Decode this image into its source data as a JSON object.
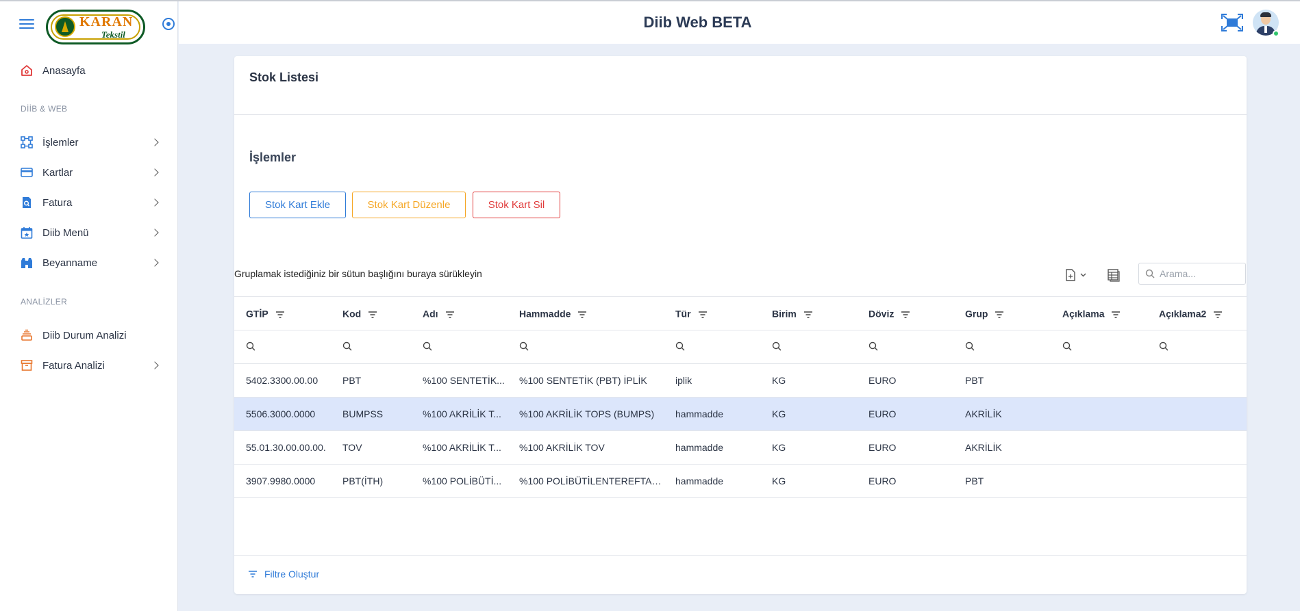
{
  "app": {
    "title": "Diib Web BETA",
    "logo_text": "KARAN",
    "logo_subtext": "Tekstil"
  },
  "sidebar": {
    "items": [
      {
        "label": "Anasayfa",
        "icon": "home-icon"
      },
      {
        "label": "İşlemler",
        "icon": "workflow-icon"
      },
      {
        "label": "Kartlar",
        "icon": "credit-card-icon"
      },
      {
        "label": "Fatura",
        "icon": "invoice-search-icon"
      },
      {
        "label": "Diib Menü",
        "icon": "calendar-icon"
      },
      {
        "label": "Beyanname",
        "icon": "customs-icon"
      },
      {
        "label": "Diib Durum Analizi",
        "icon": "stack-icon"
      },
      {
        "label": "Fatura Analizi",
        "icon": "archive-icon"
      }
    ],
    "sections": [
      "DİİB & WEB",
      "ANALİZLER"
    ]
  },
  "page": {
    "card_title": "Stok Listesi",
    "section_title": "İşlemler",
    "buttons": {
      "add": "Stok Kart Ekle",
      "edit": "Stok Kart Düzenle",
      "delete": "Stok Kart Sil"
    },
    "group_panel": "Gruplamak istediğiniz bir sütun başlığını buraya sürükleyin",
    "search_placeholder": "Arama...",
    "filter_builder": "Filtre Oluştur"
  },
  "table": {
    "columns": [
      "GTİP",
      "Kod",
      "Adı",
      "Hammadde",
      "Tür",
      "Birim",
      "Döviz",
      "Grup",
      "Açıklama",
      "Açıklama2"
    ],
    "rows": [
      [
        "5402.3300.00.00",
        "PBT",
        "%100 SENTETİK...",
        "%100 SENTETİK (PBT) İPLİK",
        "iplik",
        "KG",
        "EURO",
        "PBT",
        "",
        ""
      ],
      [
        "5506.3000.0000",
        "BUMPSS",
        "%100 AKRİLİK T...",
        "%100 AKRİLİK TOPS (BUMPS)",
        "hammadde",
        "KG",
        "EURO",
        "AKRİLİK",
        "",
        ""
      ],
      [
        "55.01.30.00.00.00.",
        "TOV",
        "%100 AKRİLİK T...",
        "%100 AKRİLİK TOV",
        "hammadde",
        "KG",
        "EURO",
        "AKRİLİK",
        "",
        ""
      ],
      [
        "3907.9980.0000",
        "PBT(İTH)",
        "%100 POLİBÜTİ...",
        "%100 POLİBÜTİLENTEREFTAL...",
        "hammadde",
        "KG",
        "EURO",
        "PBT",
        "",
        ""
      ]
    ],
    "selected_row": 1
  },
  "colors": {
    "accent": "#2f7bd8",
    "warning": "#f5a623",
    "danger": "#e03a3a",
    "selected_row": "#dce6fb",
    "background": "#e9eef7"
  }
}
